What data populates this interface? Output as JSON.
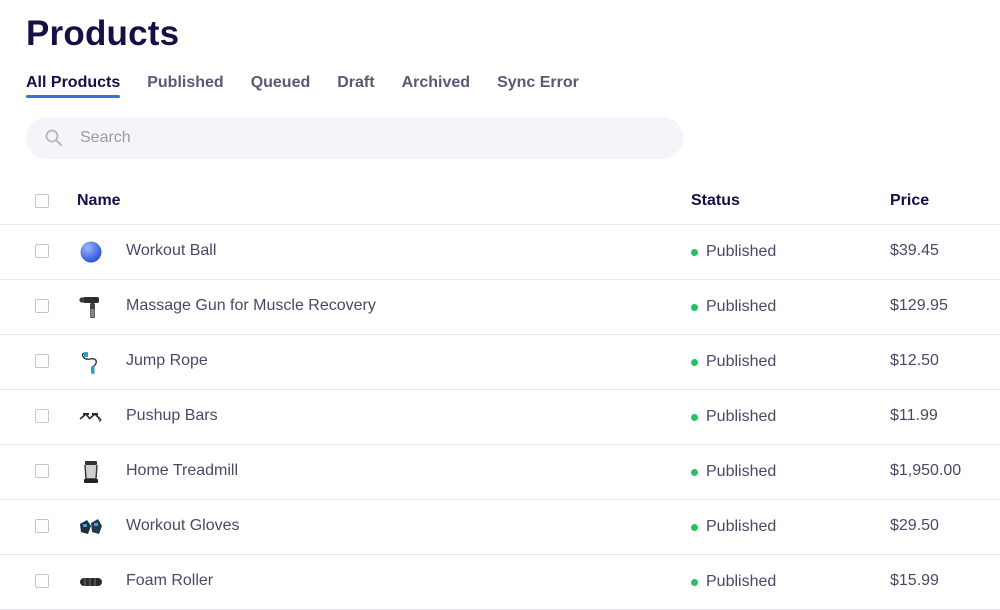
{
  "page": {
    "title": "Products"
  },
  "tabs": [
    {
      "label": "All Products",
      "active": true
    },
    {
      "label": "Published"
    },
    {
      "label": "Queued"
    },
    {
      "label": "Draft"
    },
    {
      "label": "Archived"
    },
    {
      "label": "Sync Error"
    }
  ],
  "search": {
    "placeholder": "Search",
    "icon": "search-icon"
  },
  "table": {
    "columns": {
      "name": "Name",
      "status": "Status",
      "price": "Price"
    },
    "rows": [
      {
        "name": "Workout Ball",
        "status": "Published",
        "price": "$39.45",
        "thumbnail": "workout-ball-thumbnail"
      },
      {
        "name": "Massage Gun for Muscle Recovery",
        "status": "Published",
        "price": "$129.95",
        "thumbnail": "massage-gun-thumbnail"
      },
      {
        "name": "Jump Rope",
        "status": "Published",
        "price": "$12.50",
        "thumbnail": "jump-rope-thumbnail"
      },
      {
        "name": "Pushup Bars",
        "status": "Published",
        "price": "$11.99",
        "thumbnail": "pushup-bars-thumbnail"
      },
      {
        "name": "Home Treadmill",
        "status": "Published",
        "price": "$1,950.00",
        "thumbnail": "treadmill-thumbnail"
      },
      {
        "name": "Workout Gloves",
        "status": "Published",
        "price": "$29.50",
        "thumbnail": "gloves-thumbnail"
      },
      {
        "name": "Foam Roller",
        "status": "Published",
        "price": "$15.99",
        "thumbnail": "foam-roller-thumbnail"
      }
    ]
  },
  "colors": {
    "title": "#160f47",
    "accent": "#3573d9",
    "published": "#22c35e",
    "search_bg": "#f5f5f9"
  }
}
